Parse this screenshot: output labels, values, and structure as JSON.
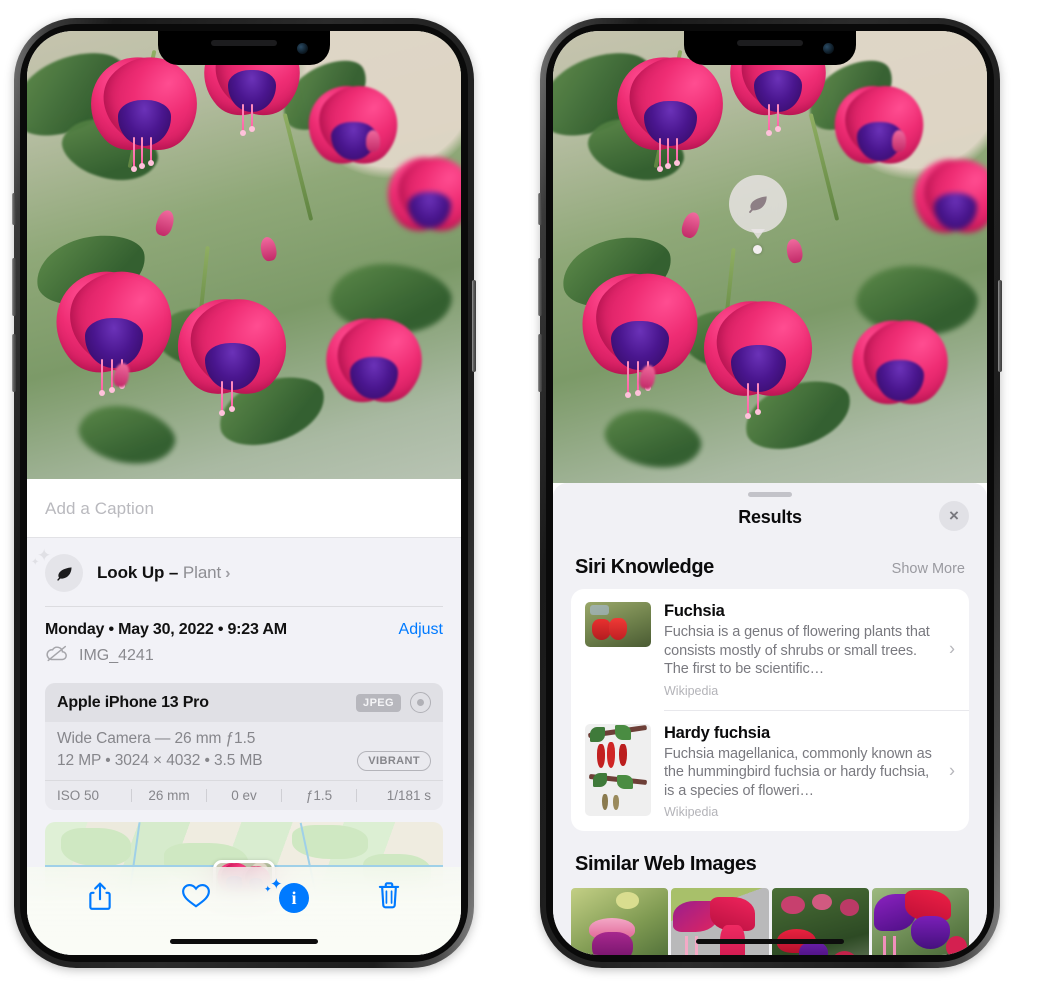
{
  "left_phone": {
    "caption_field": {
      "placeholder": "Add a Caption",
      "value": ""
    },
    "lookup_row": {
      "label": "Look Up –",
      "subject": "Plant",
      "chevron": "›",
      "icon": "leaf-icon"
    },
    "date_row": {
      "datetime": "Monday • May 30, 2022 • 9:23 AM",
      "adjust_label": "Adjust"
    },
    "file_row": {
      "icon": "icloud-slash-icon",
      "filename": "IMG_4241"
    },
    "exif": {
      "device": "Apple iPhone 13 Pro",
      "format_badge": "JPEG",
      "lens_icon": "aperture-icon",
      "lens_line": "Wide Camera — 26 mm ƒ1.5",
      "size_line": "12 MP • 3024 × 4032 • 3.5 MB",
      "style_badge": "VIBRANT",
      "stats": [
        "ISO 50",
        "26 mm",
        "0 ev",
        "ƒ1.5",
        "1/181 s"
      ]
    },
    "toolbar": {
      "share_label": "share-icon",
      "favorite_label": "heart-icon",
      "info_label": "info-sparkle-icon",
      "delete_label": "trash-icon"
    }
  },
  "right_phone": {
    "visual_lookup_badge": {
      "icon": "leaf-icon"
    },
    "sheet": {
      "title": "Results",
      "close_label": "×",
      "sections": [
        {
          "title": "Siri Knowledge",
          "action": "Show More",
          "items": [
            {
              "title": "Fuchsia",
              "description": "Fuchsia is a genus of flowering plants that consists mostly of shrubs or small trees. The first to be scientific…",
              "source": "Wikipedia",
              "chevron": "›"
            },
            {
              "title": "Hardy fuchsia",
              "description": "Fuchsia magellanica, commonly known as the hummingbird fuchsia or hardy fuchsia, is a species of floweri…",
              "source": "Wikipedia",
              "chevron": "›"
            }
          ]
        },
        {
          "title": "Similar Web Images",
          "action": "",
          "thumbnails": [
            "web-image-1",
            "web-image-2",
            "web-image-3",
            "web-image-4"
          ]
        }
      ]
    }
  },
  "colors": {
    "accent_blue": "#007aff",
    "sheet_bg": "#f1f1f5",
    "card_bg": "#ffffff",
    "secondary_text": "#8e8e93",
    "exif_bg": "#eaeaef"
  }
}
